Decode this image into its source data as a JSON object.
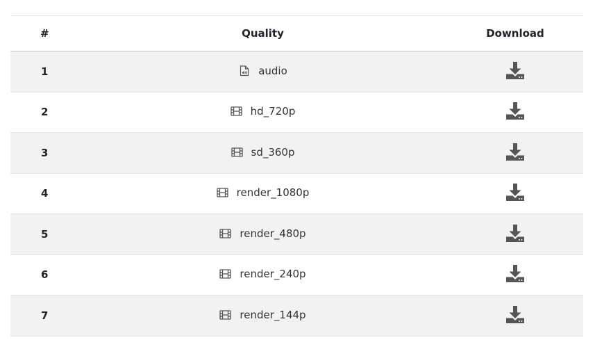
{
  "table": {
    "headers": {
      "num": "#",
      "quality": "Quality",
      "download": "Download"
    },
    "rows": [
      {
        "num": "1",
        "quality": "audio",
        "icon": "audio-file-icon"
      },
      {
        "num": "2",
        "quality": "hd_720p",
        "icon": "film-icon"
      },
      {
        "num": "3",
        "quality": "sd_360p",
        "icon": "film-icon"
      },
      {
        "num": "4",
        "quality": "render_1080p",
        "icon": "film-icon"
      },
      {
        "num": "5",
        "quality": "render_480p",
        "icon": "film-icon"
      },
      {
        "num": "6",
        "quality": "render_240p",
        "icon": "film-icon"
      },
      {
        "num": "7",
        "quality": "render_144p",
        "icon": "film-icon"
      }
    ]
  },
  "colors": {
    "stripe": "#f2f2f2",
    "icon": "#555555",
    "text": "#212529"
  }
}
